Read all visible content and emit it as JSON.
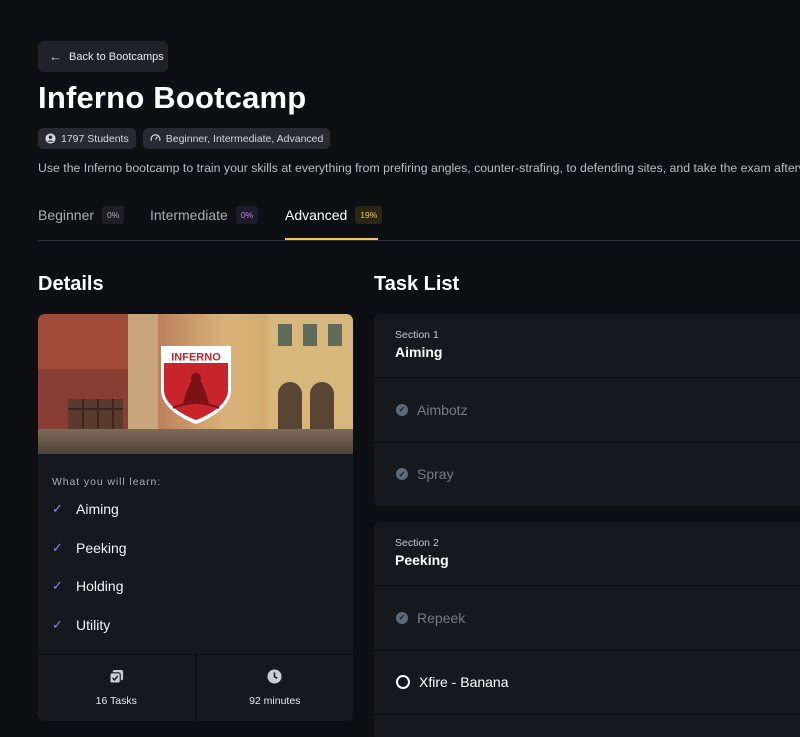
{
  "back_button": {
    "label": "Back to Bootcamps"
  },
  "title": "Inferno Bootcamp",
  "meta": {
    "students": "1797 Students",
    "levels": "Beginner, Intermediate, Advanced"
  },
  "description": "Use the Inferno bootcamp to train your skills at everything from prefiring angles, counter-strafing, to defending sites, and take the exam afterwa",
  "tabs": [
    {
      "label": "Beginner",
      "progress": "0%"
    },
    {
      "label": "Intermediate",
      "progress": "0%"
    },
    {
      "label": "Advanced",
      "progress": "19%",
      "active": true
    }
  ],
  "details": {
    "heading": "Details",
    "hero_logo_text": "INFERNO",
    "learn_label": "What you will learn:",
    "learn_items": [
      "Aiming",
      "Peeking",
      "Holding",
      "Utility"
    ],
    "tasks_count": "16 Tasks",
    "duration": "92 minutes"
  },
  "task_list": {
    "heading": "Task List",
    "sections": [
      {
        "sub": "Section 1",
        "name": "Aiming",
        "tasks": [
          {
            "label": "Aimbotz",
            "done": true
          },
          {
            "label": "Spray",
            "done": true
          }
        ]
      },
      {
        "sub": "Section 2",
        "name": "Peeking",
        "tasks": [
          {
            "label": "Repeek",
            "done": true
          },
          {
            "label": "Xfire - Banana",
            "done": false
          }
        ]
      }
    ]
  },
  "colors": {
    "background": "#0d0f13",
    "card": "#15191f",
    "accent_yellow": "#f2c94c",
    "accent_purple": "#b98cf0",
    "check": "#8f8af0"
  }
}
